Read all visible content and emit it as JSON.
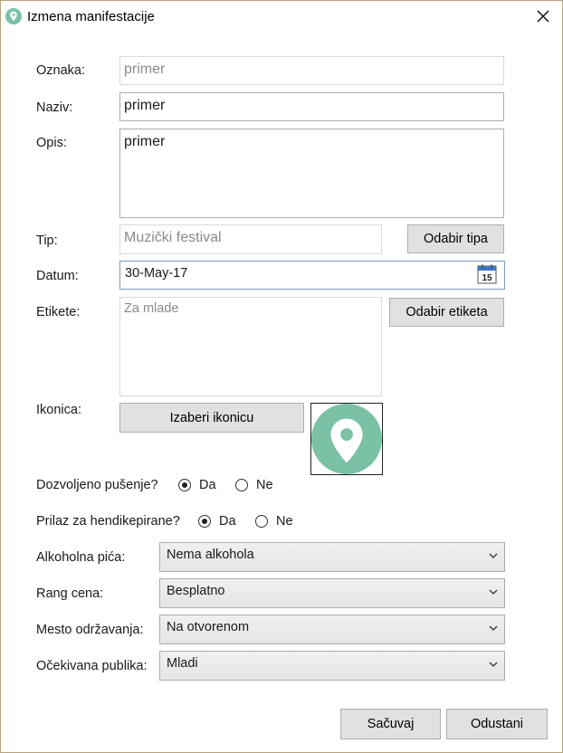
{
  "window": {
    "title": "Izmena manifestacije"
  },
  "labels": {
    "oznaka": "Oznaka:",
    "naziv": "Naziv:",
    "opis": "Opis:",
    "tip": "Tip:",
    "datum": "Datum:",
    "etikete": "Etikete:",
    "ikonica": "Ikonica:",
    "pusenje": "Dozvoljeno pušenje?",
    "hendikep": "Prilaz za hendikepirane?",
    "alkohol": "Alkoholna pića:",
    "cena": "Rang cena:",
    "mesto": "Mesto održavanja:",
    "publika": "Očekivana publika:"
  },
  "fields": {
    "oznaka": "primer",
    "naziv": "primer",
    "opis": "primer",
    "tip": "Muzički festival",
    "datum": "30-May-17",
    "calendar_day": "15",
    "etikete": "Za mlade"
  },
  "buttons": {
    "odabir_tipa": "Odabir tipa",
    "odabir_etiketa": "Odabir etiketa",
    "izaberi_ikonicu": "Izaberi ikonicu",
    "sacuvaj": "Sačuvaj",
    "odustani": "Odustani"
  },
  "radios": {
    "da": "Da",
    "ne": "Ne",
    "pusenje_selected": "Da",
    "hendikep_selected": "Da"
  },
  "combos": {
    "alkohol": "Nema alkohola",
    "cena": "Besplatno",
    "mesto": "Na otvorenom",
    "publika": "Mladi"
  },
  "colors": {
    "icon_teal": "#7ac1a6",
    "border_title": "#b9a27a"
  }
}
